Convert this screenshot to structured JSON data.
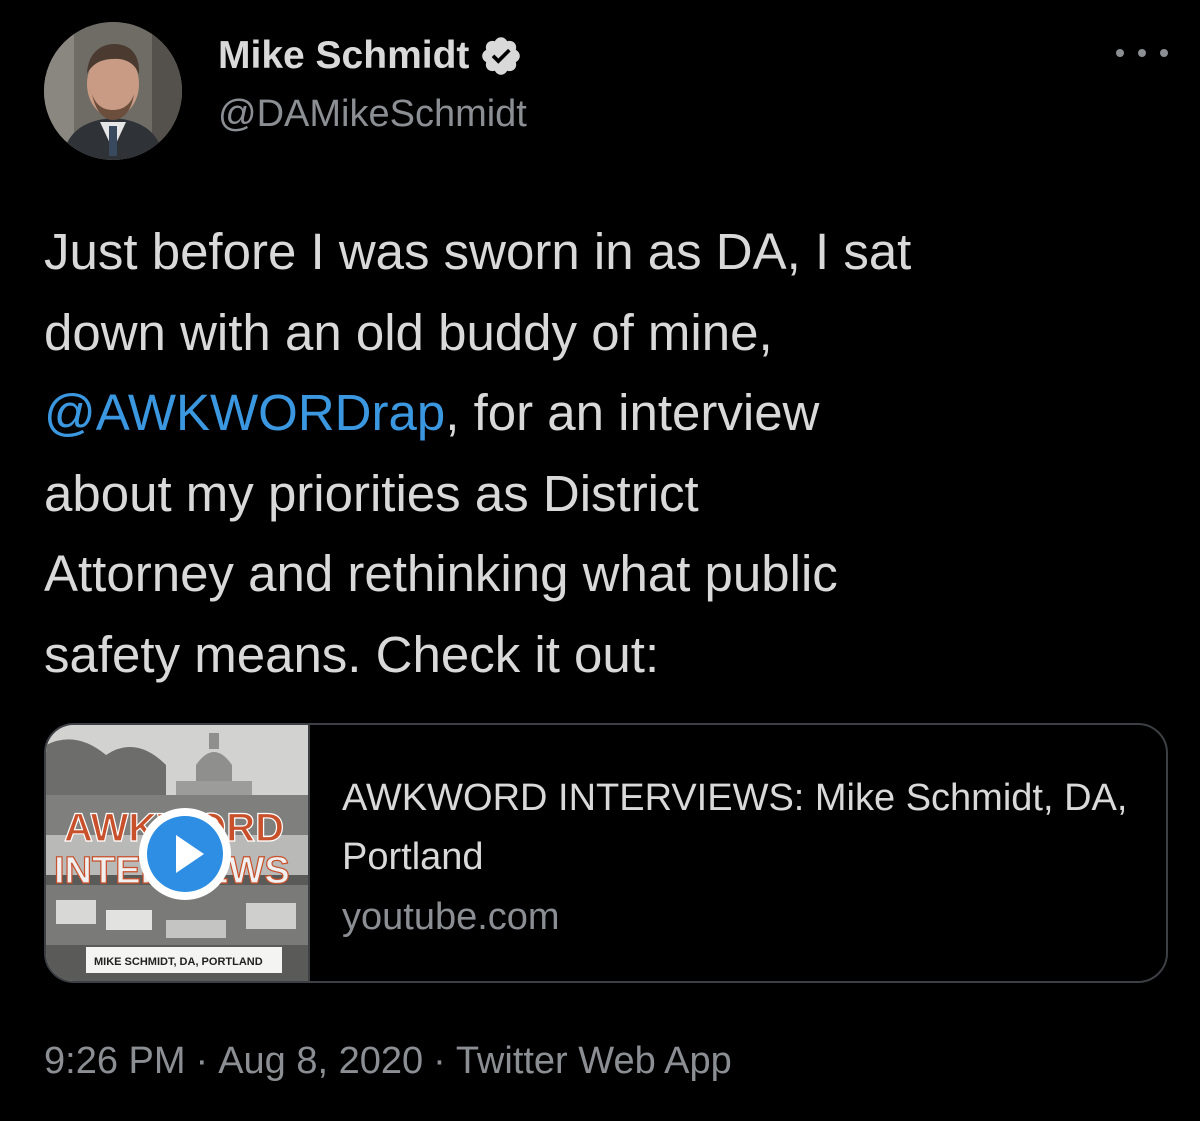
{
  "author": {
    "display_name": "Mike Schmidt",
    "handle": "@DAMikeSchmidt",
    "verified_icon": "verified-badge-icon",
    "avatar_icon": "profile-photo"
  },
  "more_icon": "more-horizontal-icon",
  "tweet": {
    "line1": "Just before I was sworn in as DA, I sat",
    "line2": "down with an old buddy of mine,",
    "mention": "@AWKWORDrap",
    "line3_rest": ", for an interview",
    "line4": "about my priorities as District",
    "line5": "Attorney and rethinking what public",
    "line6": "safety means. Check it out:"
  },
  "card": {
    "title": "AWKWORD INTERVIEWS: Mike Schmidt, DA, Portland",
    "domain": "youtube.com",
    "thumbnail": {
      "headline_top": "AWKWORD",
      "headline_bottom": "INTERVIEWS",
      "caption": "MIKE SCHMIDT, DA, PORTLAND"
    },
    "play_icon": "play-icon"
  },
  "meta": {
    "time": "9:26 PM",
    "date": "Aug 8, 2020",
    "source": "Twitter Web App",
    "separator": "·"
  },
  "colors": {
    "background": "#000000",
    "text": "#d9d9d9",
    "secondary": "#8b8f94",
    "link": "#3b98e0",
    "border": "#3c3f44",
    "verified": "#d9d9d9"
  }
}
